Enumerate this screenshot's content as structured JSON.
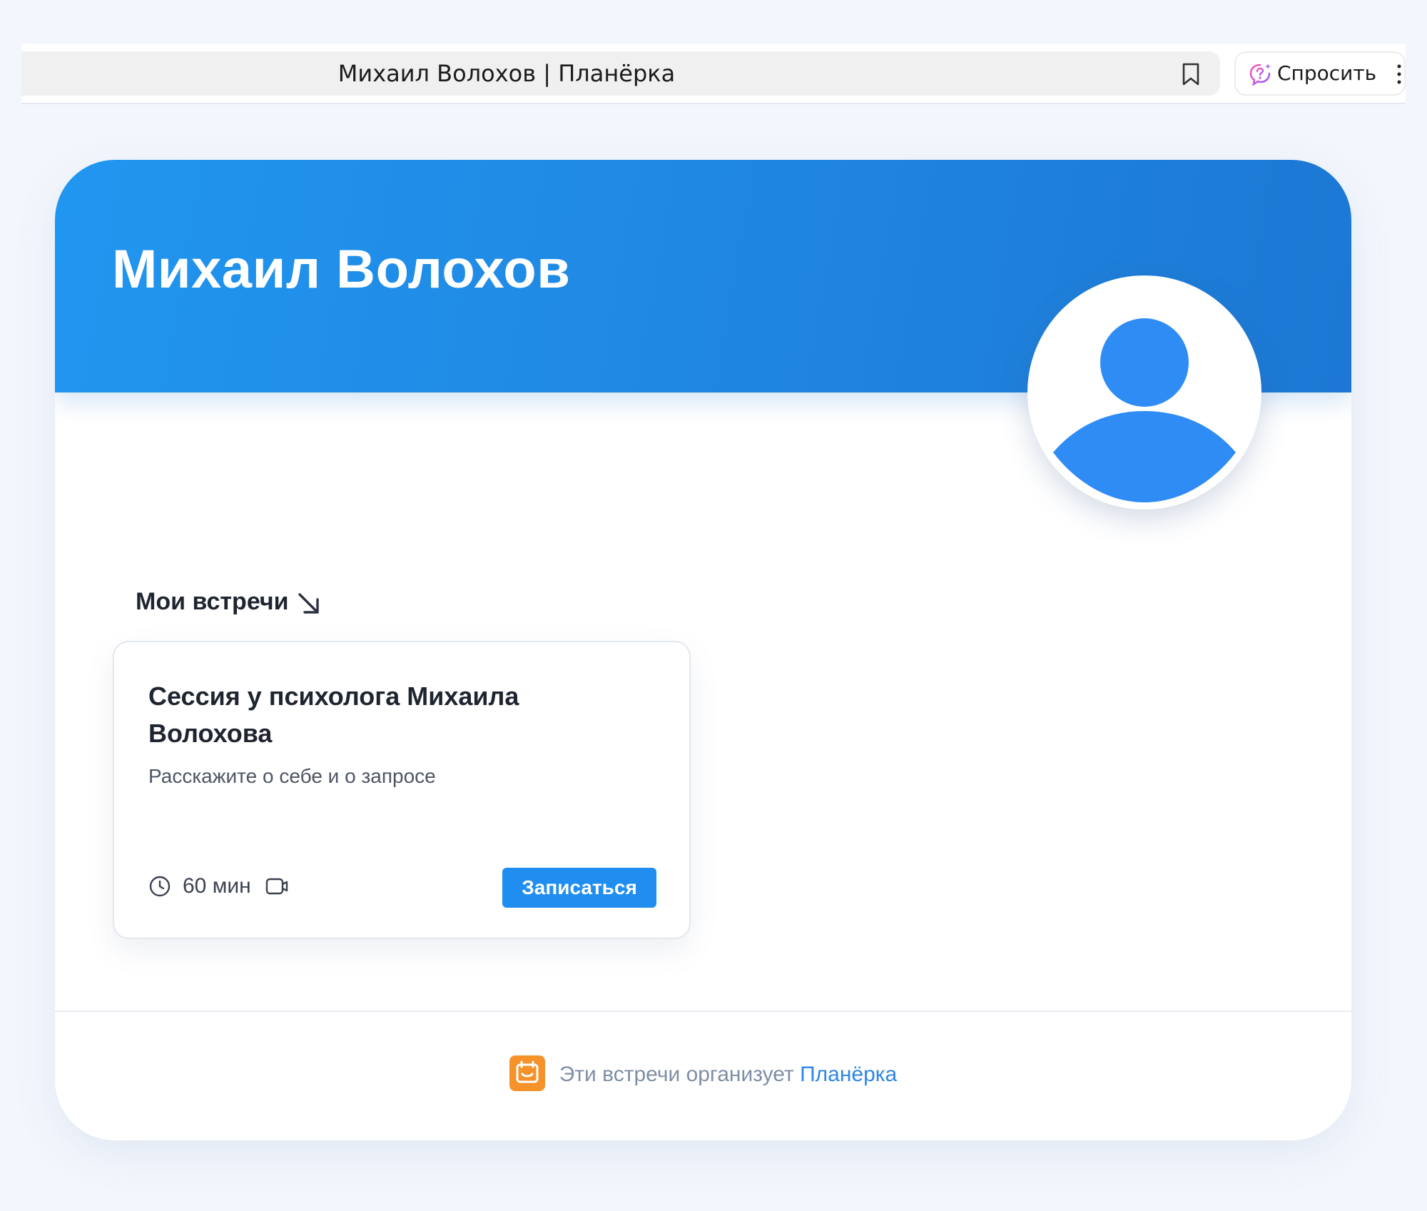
{
  "browser": {
    "tab_title": "Михаил Волохов | Планёрка",
    "ask_label": "Спросить"
  },
  "profile": {
    "name": "Михаил Волохов"
  },
  "meetings": {
    "section_title": "Мои встречи",
    "items": [
      {
        "title": "Сессия у психолога Михаила Волохова",
        "description": "Расскажите о себе и о запросе",
        "duration": "60 мин",
        "button_label": "Записаться"
      }
    ]
  },
  "footer": {
    "text": "Эти встречи организует ",
    "link_text": "Планёрка"
  },
  "colors": {
    "header_blue": "#1f86e0",
    "button_blue": "#1f8ef0",
    "avatar_blue": "#2f8cf5",
    "logo_orange": "#f5922a",
    "link_blue": "#2d86e6"
  }
}
